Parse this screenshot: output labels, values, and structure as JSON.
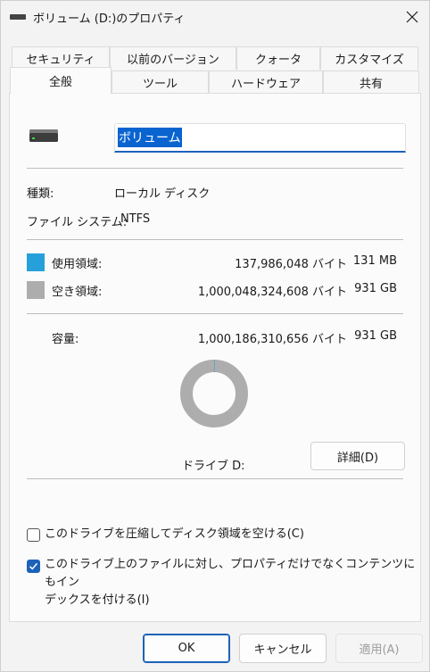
{
  "window": {
    "title": "ボリューム (D:)のプロパティ"
  },
  "tabs_row1": [
    {
      "label": "セキュリティ"
    },
    {
      "label": "以前のバージョン"
    },
    {
      "label": "クォータ"
    },
    {
      "label": "カスタマイズ"
    }
  ],
  "tabs_row2": [
    {
      "label": "全般",
      "active": true
    },
    {
      "label": "ツール"
    },
    {
      "label": "ハードウェア"
    },
    {
      "label": "共有"
    }
  ],
  "general": {
    "volume_name": "ボリューム",
    "type_label": "種類:",
    "type_value": "ローカル ディスク",
    "fs_label": "ファイル システム:",
    "fs_value": "NTFS",
    "used": {
      "label": "使用領域:",
      "bytes": "137,986,048 バイト",
      "size": "131 MB",
      "color": "#26a0da"
    },
    "free": {
      "label": "空き領域:",
      "bytes": "1,000,048,324,608 バイト",
      "size": "931 GB",
      "color": "#adadad"
    },
    "capacity": {
      "label": "容量:",
      "bytes": "1,000,186,310,656 バイト",
      "size": "931 GB"
    },
    "used_fraction": 0.000138,
    "drive_label": "ドライブ D:",
    "details_button": "詳細(D)",
    "compress": {
      "label": "このドライブを圧縮してディスク領域を空ける(C)",
      "checked": false
    },
    "index": {
      "label_line1": "このドライブ上のファイルに対し、プロパティだけでなくコンテンツにもイン",
      "label_line2": "デックスを付ける(I)",
      "checked": true
    }
  },
  "buttons": {
    "ok": "OK",
    "cancel": "キャンセル",
    "apply": "適用(A)"
  },
  "accent": "#1d62b9"
}
